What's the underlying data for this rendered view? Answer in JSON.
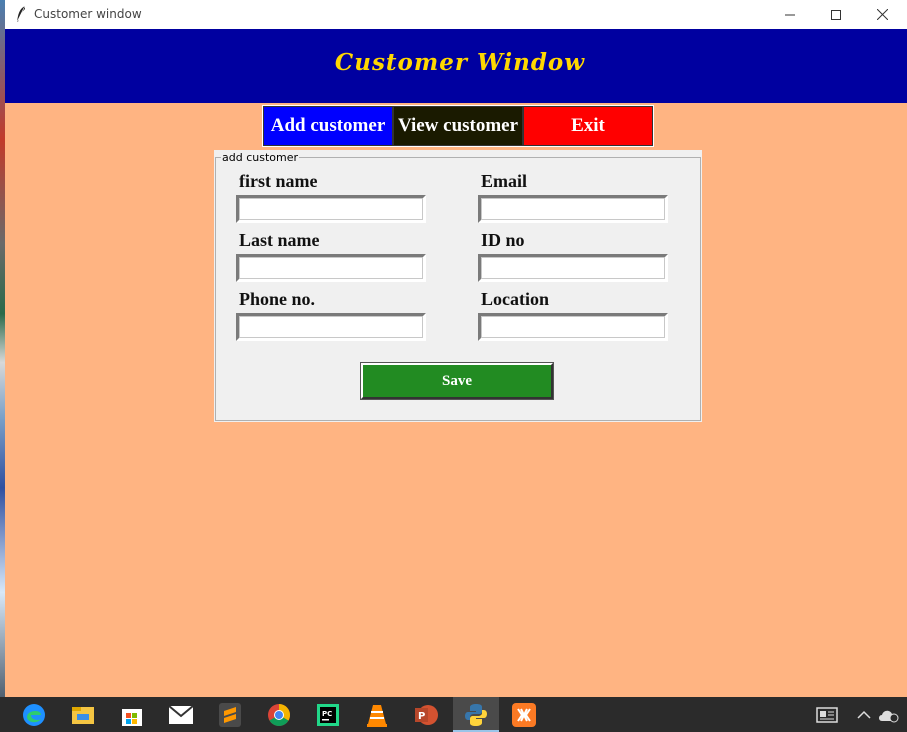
{
  "window": {
    "title": "Customer window",
    "icon": "feather-icon",
    "controls": [
      "minimize-icon",
      "maximize-icon",
      "close-icon"
    ]
  },
  "header": {
    "title": "Customer Window"
  },
  "nav": {
    "add_customer": "Add customer",
    "view_customer": "View customer",
    "exit": "Exit"
  },
  "colors": {
    "background": "#ffb482",
    "header_bg": "#0000a0",
    "header_text": "#ffd700",
    "add_btn": "#0000ff",
    "view_btn": "#1a1a00",
    "exit_btn": "#ff0000",
    "save_btn": "#228b22"
  },
  "form": {
    "legend": "add customer",
    "fields": {
      "first_name": {
        "label": "first name",
        "value": ""
      },
      "email": {
        "label": "Email",
        "value": ""
      },
      "last_name": {
        "label": "Last name",
        "value": ""
      },
      "id_no": {
        "label": "ID no",
        "value": ""
      },
      "phone": {
        "label": "Phone no.",
        "value": ""
      },
      "location": {
        "label": "Location",
        "value": ""
      }
    },
    "save_label": "Save"
  },
  "taskbar": {
    "icons": [
      "edge-icon",
      "file-explorer-icon",
      "microsoft-store-icon",
      "mail-icon",
      "sublime-text-icon",
      "chrome-icon",
      "pycharm-icon",
      "vlc-icon",
      "powerpoint-icon",
      "python-icon",
      "xampp-icon"
    ],
    "tray": [
      "news-icon",
      "chevron-up-icon",
      "onedrive-icon"
    ]
  }
}
